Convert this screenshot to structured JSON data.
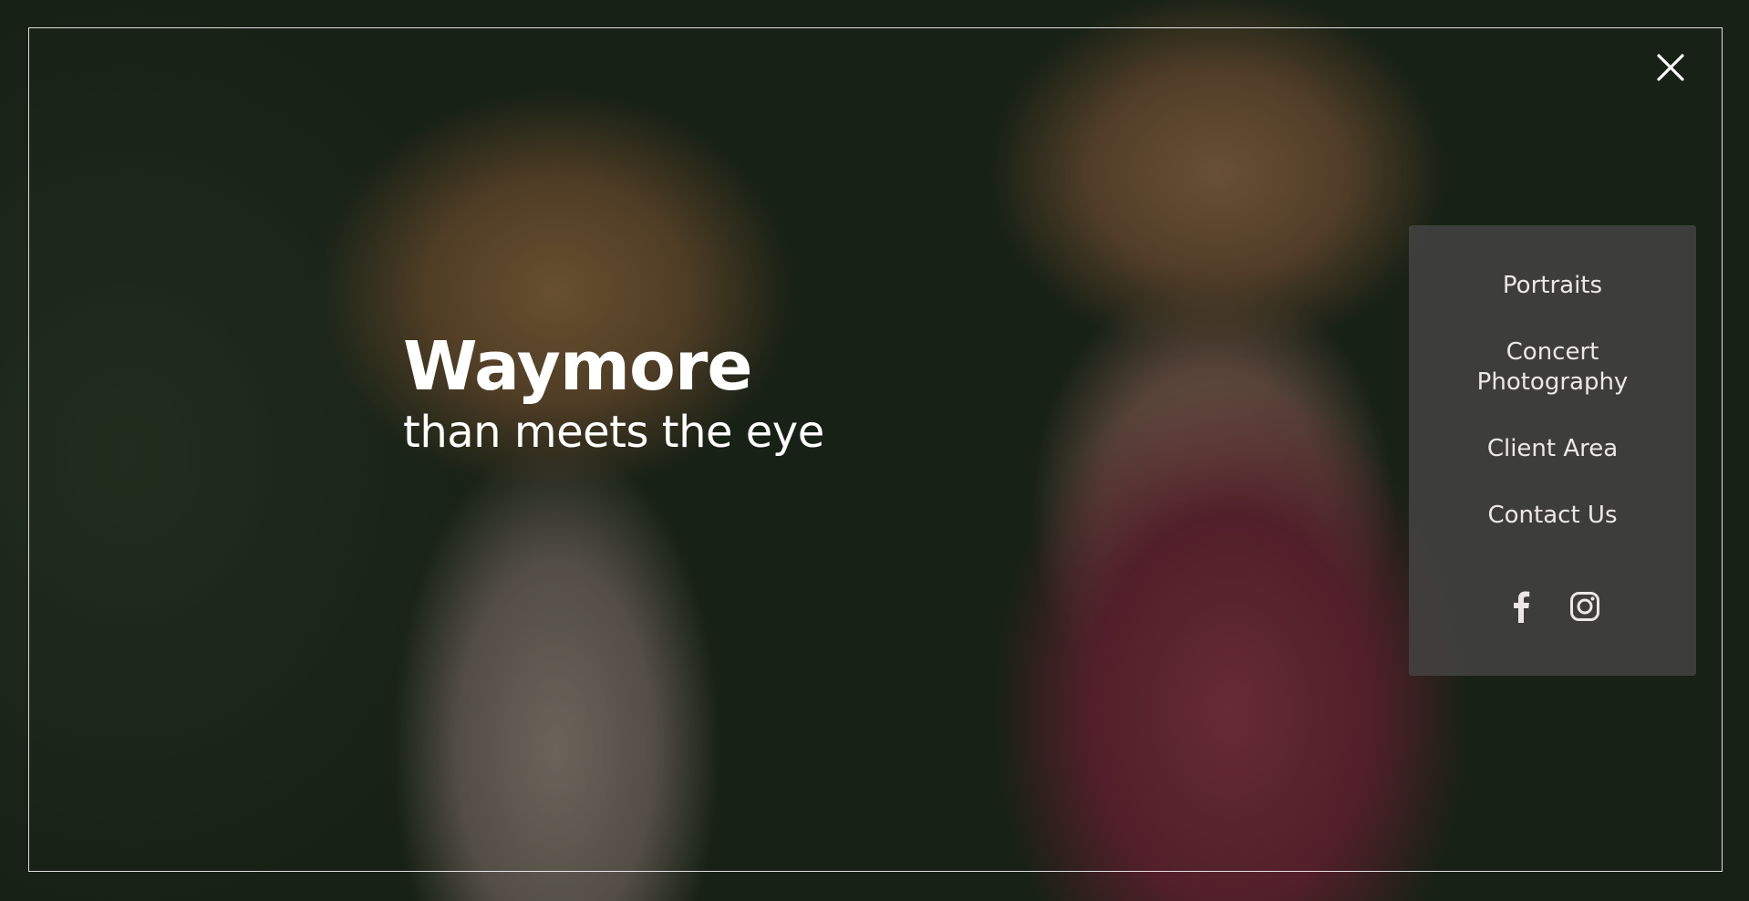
{
  "site": {
    "title": "Waymore",
    "tagline": "than meets the eye"
  },
  "menu": {
    "items": [
      {
        "label": "Portraits"
      },
      {
        "label": "Concert Photography"
      },
      {
        "label": "Client Area"
      },
      {
        "label": "Contact Us"
      }
    ]
  },
  "social": {
    "links": [
      {
        "icon": "facebook-icon"
      },
      {
        "icon": "instagram-icon"
      }
    ]
  },
  "icons": {
    "close": "close-icon"
  },
  "colors": {
    "text": "#ffffff",
    "menu_text": "#ece8e6",
    "menu_panel": "#464444"
  }
}
